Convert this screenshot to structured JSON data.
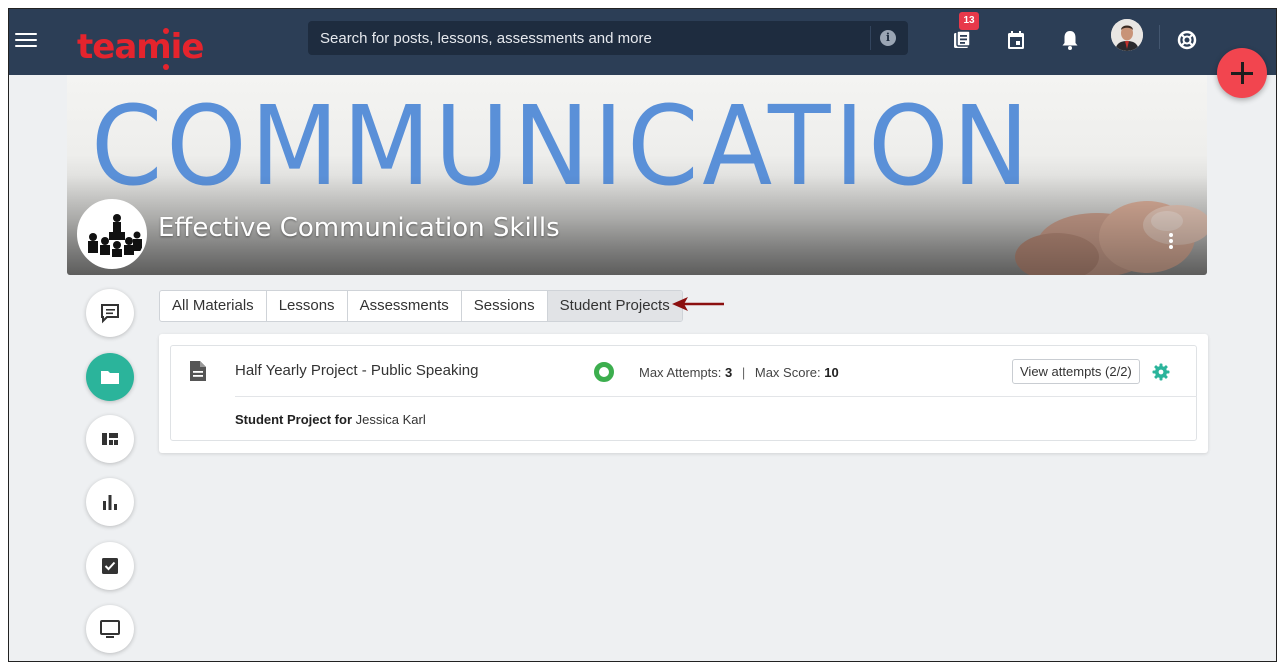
{
  "header": {
    "logo_text": "teamie",
    "search_placeholder": "Search for posts, lessons, assessments and more",
    "notification_count": "13",
    "icons": [
      "menu-icon",
      "news-feed-icon",
      "calendar-icon",
      "bell-icon",
      "avatar",
      "help-lifebuoy-icon",
      "add-icon"
    ]
  },
  "course": {
    "banner_word": "COMMUNICATION",
    "title": "Effective Communication Skills"
  },
  "rail": [
    "discussion-icon",
    "folder-icon",
    "dashboard-icon",
    "bar-chart-icon",
    "checkbox-icon",
    "monitor-icon"
  ],
  "tabs": [
    {
      "label": "All Materials"
    },
    {
      "label": "Lessons"
    },
    {
      "label": "Assessments"
    },
    {
      "label": "Sessions"
    },
    {
      "label": "Student Projects",
      "active": true
    }
  ],
  "material": {
    "title": "Half Yearly Project - Public Speaking",
    "max_attempts_label": "Max Attempts:",
    "max_attempts_value": "3",
    "max_score_label": "Max Score:",
    "max_score_value": "10",
    "separator": "|",
    "view_attempts_label": "View attempts (2/2)",
    "sub_label": "Student Project for",
    "sub_value": "Jessica Karl"
  },
  "colors": {
    "header_bg": "#2c3e56",
    "brand_red": "#e5242d",
    "accent_teal": "#2bb49b",
    "status_green": "#3cae4e",
    "fab_red": "#f2454f",
    "arrow": "#8b1010"
  }
}
